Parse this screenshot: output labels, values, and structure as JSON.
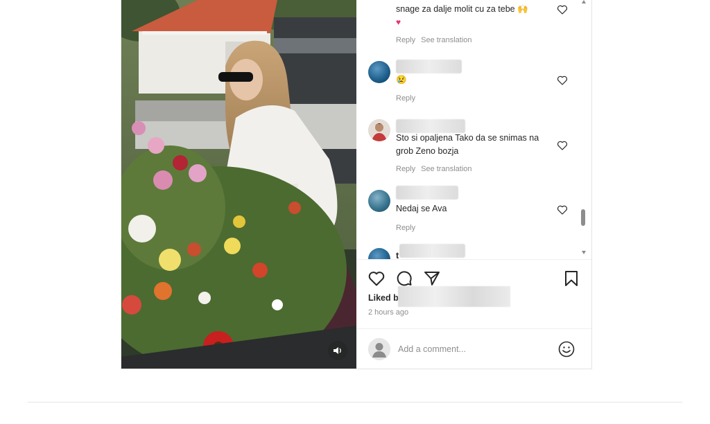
{
  "post": {
    "comments": [
      {
        "text": "snage za dalje molit cu za tebe",
        "emoji_a": "🙌",
        "emoji_b": "♥",
        "reply_label": "Reply",
        "translate_label": "See translation"
      },
      {
        "text": "😢",
        "reply_label": "Reply"
      },
      {
        "text": "Sto si opaljena Tako da se snimas na grob Zeno bozja",
        "reply_label": "Reply",
        "translate_label": "See translation"
      },
      {
        "text": "Nedaj se Ava",
        "reply_label": "Reply"
      },
      {
        "partial_username": "t"
      }
    ],
    "liked_by_label": "Liked b",
    "time_ago": "2 hours ago",
    "comment_placeholder": "Add a comment..."
  },
  "icons": {
    "like": "heart-outline-icon",
    "comment": "comment-bubble-icon",
    "share": "paper-plane-icon",
    "save": "bookmark-icon",
    "emoji": "smiley-face-icon",
    "mute": "speaker-icon"
  },
  "colors": {
    "text": "#262626",
    "secondary": "#8e8e8e",
    "heart_emoji": "#e8336b",
    "border": "#e3e3e3"
  }
}
